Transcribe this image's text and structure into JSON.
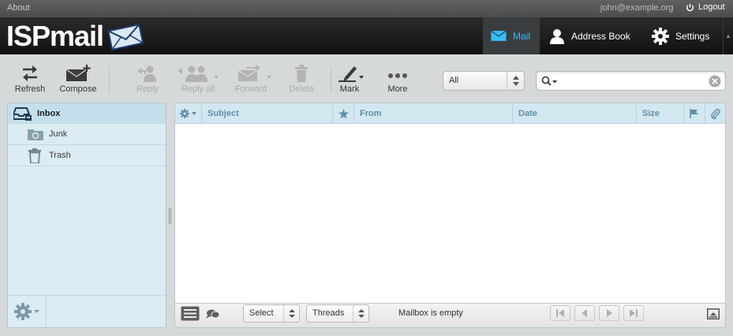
{
  "topline": {
    "about": "About",
    "user": "john@example.org",
    "logout": "Logout"
  },
  "header": {
    "logo": "ISPmail",
    "tasks": [
      {
        "label": "Mail",
        "icon": "envelope-icon",
        "active": true
      },
      {
        "label": "Address Book",
        "icon": "person-icon",
        "active": false
      },
      {
        "label": "Settings",
        "icon": "gear-icon",
        "active": false
      }
    ],
    "accent": "#37beff"
  },
  "toolbar": {
    "refresh": "Refresh",
    "compose": "Compose",
    "reply": "Reply",
    "reply_all": "Reply all",
    "forward": "Forward",
    "delete": "Delete",
    "mark": "Mark",
    "more": "More",
    "filter_value": "All",
    "search_placeholder": ""
  },
  "folders": {
    "items": [
      {
        "label": "Inbox",
        "icon": "inbox-icon",
        "selected": true
      },
      {
        "label": "Junk",
        "icon": "junk-icon",
        "selected": false
      },
      {
        "label": "Trash",
        "icon": "trash-icon",
        "selected": false
      }
    ]
  },
  "messages": {
    "columns": {
      "subject": "Subject",
      "from": "From",
      "date": "Date",
      "size": "Size"
    },
    "rows": [],
    "footer": {
      "select": "Select",
      "threads": "Threads",
      "status": "Mailbox is empty"
    }
  }
}
